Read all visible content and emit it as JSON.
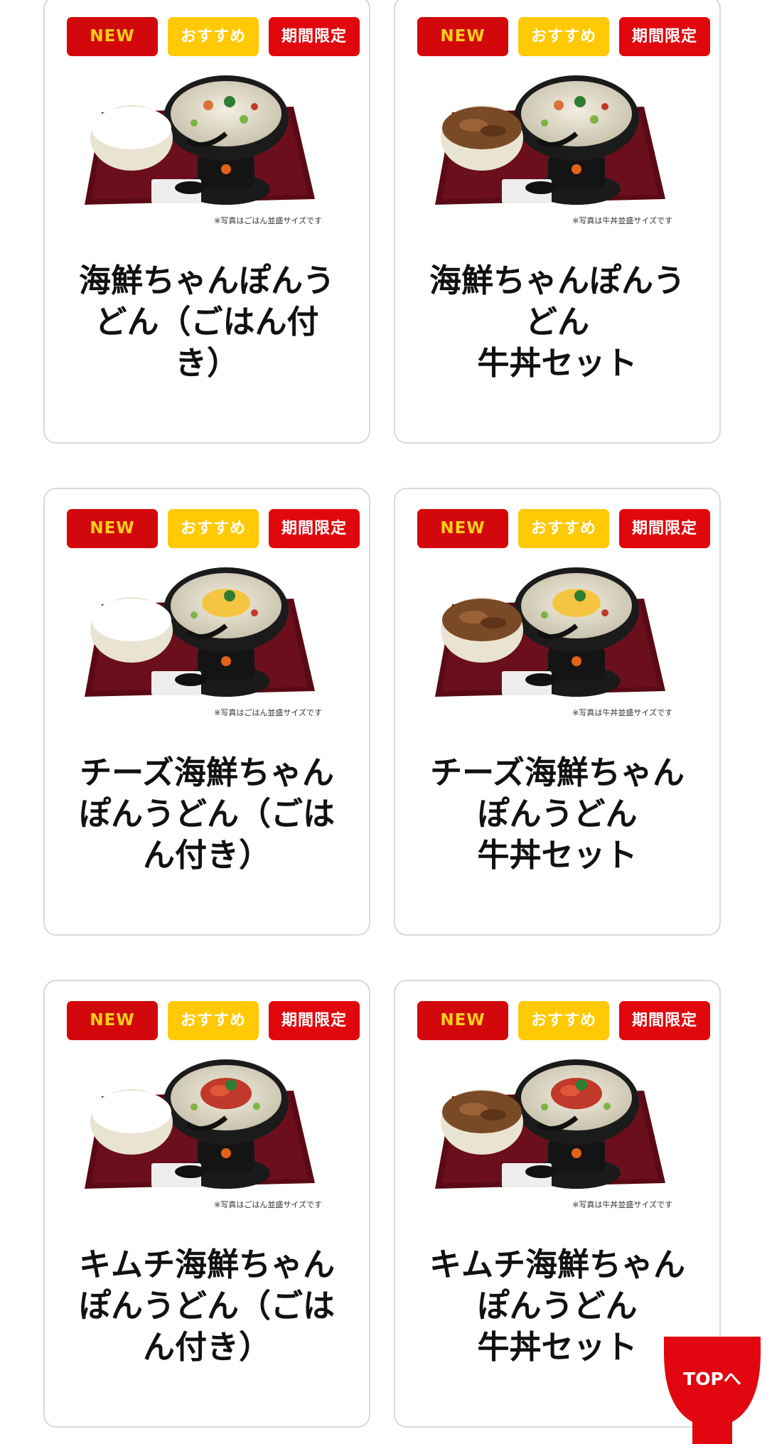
{
  "colors": {
    "badge_new_bg": "#d3080c",
    "badge_new_text": "#ffcf1a",
    "badge_recommended_bg": "#ffc905",
    "badge_limited_bg": "#e0070d",
    "tray": "#5a0a14",
    "top_button": "#e10610"
  },
  "badges": {
    "new": "NEW",
    "recommended": "おすすめ",
    "limited": "期間限定"
  },
  "items": [
    {
      "title": "海鮮ちゃんぽんう\nどん（ごはん付\nき）",
      "photo_note": "※写真はごはん並盛サイズです",
      "side": "rice",
      "topping": "plain"
    },
    {
      "title": "海鮮ちゃんぽんう\nどん\n牛丼セット",
      "photo_note": "※写真は牛丼並盛サイズです",
      "side": "gyudon",
      "topping": "plain"
    },
    {
      "title": "チーズ海鮮ちゃん\nぽんうどん（ごは\nん付き）",
      "photo_note": "※写真はごはん並盛サイズです",
      "side": "rice",
      "topping": "cheese"
    },
    {
      "title": "チーズ海鮮ちゃん\nぽんうどん\n牛丼セット",
      "photo_note": "※写真は牛丼並盛サイズです",
      "side": "gyudon",
      "topping": "cheese"
    },
    {
      "title": "キムチ海鮮ちゃん\nぽんうどん（ごは\nん付き）",
      "photo_note": "※写真はごはん並盛サイズです",
      "side": "rice",
      "topping": "kimchi"
    },
    {
      "title": "キムチ海鮮ちゃん\nぽんうどん\n牛丼セット",
      "photo_note": "※写真は牛丼並盛サイズです",
      "side": "gyudon",
      "topping": "kimchi"
    }
  ],
  "top_button": {
    "label": "TOPへ"
  }
}
